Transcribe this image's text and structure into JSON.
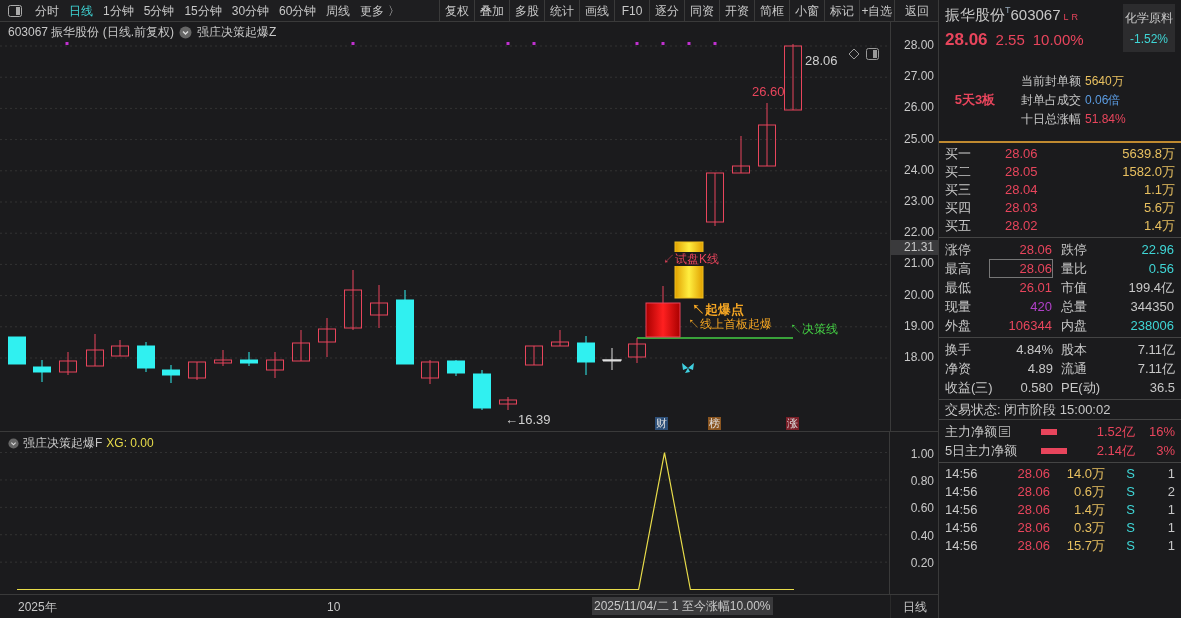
{
  "toolbar": {
    "periods": [
      {
        "label": "分时",
        "selected": false
      },
      {
        "label": "日线",
        "selected": true
      },
      {
        "label": "1分钟",
        "selected": false
      },
      {
        "label": "5分钟",
        "selected": false
      },
      {
        "label": "15分钟",
        "selected": false
      },
      {
        "label": "30分钟",
        "selected": false
      },
      {
        "label": "60分钟",
        "selected": false
      },
      {
        "label": "周线",
        "selected": false
      },
      {
        "label": "更多 〉",
        "selected": false
      }
    ],
    "buttons": [
      "复权",
      "叠加",
      "多股",
      "统计",
      "画线",
      "F10",
      "逐分",
      "同资",
      "开资",
      "简框",
      "小窗",
      "标记",
      "+自选",
      "返回"
    ]
  },
  "chart": {
    "title": "603067 振华股份 (日线.前复权)",
    "indicator": "强庄决策起爆Z",
    "price_ticks": [
      "28.00",
      "27.00",
      "26.00",
      "25.00",
      "24.00",
      "23.00",
      "22.00",
      "21.00",
      "20.00",
      "19.00",
      "18.00"
    ],
    "cursor_price": "21.31",
    "price_notes": [
      {
        "text": "28.06",
        "color": "#d0d0d0"
      },
      {
        "text": "26.60",
        "color": "#e8455c"
      },
      {
        "text": "←16.39",
        "color": "#d0d0d0"
      }
    ],
    "signals": [
      {
        "text": "↙试盘K线",
        "color": "#e8455c"
      },
      {
        "text": "↖起爆点",
        "color": "#f5a623"
      },
      {
        "text": "↖线上首板起爆",
        "color": "#f5a623"
      },
      {
        "text": "↖决策线",
        "color": "#44d044"
      }
    ],
    "events": [
      {
        "text": "财",
        "color": "#2d4f78"
      },
      {
        "text": "榜",
        "color": "#8a5520"
      },
      {
        "text": "涨",
        "color": "#7a1f28"
      }
    ]
  },
  "indicator_panel": {
    "name": "强庄决策起爆F",
    "reading": "XG: 0.00",
    "chart_data": {
      "type": "line",
      "series": [
        {
          "color": "#e8dc4a",
          "values": [
            0,
            0,
            0,
            0,
            0,
            0,
            0,
            0,
            0,
            0,
            0,
            0,
            0,
            0,
            0,
            0,
            0,
            0,
            0,
            0,
            0,
            0,
            0,
            0,
            0,
            1,
            0,
            0,
            0,
            0,
            0,
            null,
            null,
            null
          ]
        }
      ],
      "ylim": [
        -0.04,
        1.15
      ],
      "grid": true,
      "yticks": [
        {
          "value": 0.2,
          "label": "0.20"
        },
        {
          "value": 0.4,
          "label": "0.40"
        },
        {
          "value": 0.6,
          "label": "0.60"
        },
        {
          "value": 0.8,
          "label": "0.80"
        },
        {
          "value": 1,
          "label": "1.00"
        }
      ]
    }
  },
  "time_axis": {
    "labels": [
      "2025年",
      "10"
    ],
    "cursor": "2025/11/04/二 1 至今涨幅10.00%",
    "period": "日线"
  },
  "quote": {
    "name": "振华股份",
    "mark": "T",
    "code": "603067",
    "flags": [
      "L",
      "R"
    ],
    "price": "28.06",
    "change": "2.55",
    "change_pct": "10.00%",
    "sector": "化学原料",
    "sector_pct": "-1.52%",
    "streak": "5天3板",
    "limit_info": [
      {
        "label": "当前封单额",
        "value": "5640万",
        "color": "#e8c060"
      },
      {
        "label": "封单占成交",
        "value": "0.06倍",
        "color": "#5b9be0"
      },
      {
        "label": "十日总涨幅",
        "value": "51.84%",
        "color": "#e8455c"
      }
    ],
    "bids": [
      {
        "label": "买一",
        "price": "28.06",
        "volume": "5639.8万"
      },
      {
        "label": "买二",
        "price": "28.05",
        "volume": "1582.0万"
      },
      {
        "label": "买三",
        "price": "28.04",
        "volume": "1.1万"
      },
      {
        "label": "买四",
        "price": "28.03",
        "volume": "5.6万"
      },
      {
        "label": "买五",
        "price": "28.02",
        "volume": "1.4万"
      }
    ],
    "stats": [
      {
        "label": "涨停",
        "value": "28.06",
        "color": "#e8455c",
        "boxed": false
      },
      {
        "label": "跌停",
        "value": "22.96",
        "color": "#3fd6d6",
        "boxed": false
      },
      {
        "label": "最高",
        "value": "28.06",
        "color": "#e8455c",
        "boxed": true
      },
      {
        "label": "量比",
        "value": "0.56",
        "color": "#3fd6d6",
        "boxed": false
      },
      {
        "label": "最低",
        "value": "26.01",
        "color": "#e8455c",
        "boxed": false
      },
      {
        "label": "市值",
        "value": "199.4亿",
        "color": "#c8c8c8",
        "boxed": false
      },
      {
        "label": "现量",
        "value": "420",
        "color": "#b040c8",
        "boxed": false
      },
      {
        "label": "总量",
        "value": "344350",
        "color": "#c8c8c8",
        "boxed": false
      },
      {
        "label": "外盘",
        "value": "106344",
        "color": "#e8455c",
        "boxed": false
      },
      {
        "label": "内盘",
        "value": "238006",
        "color": "#3fd6d6",
        "boxed": false
      }
    ],
    "fundamentals": [
      {
        "label": "换手",
        "value": "4.84%"
      },
      {
        "label": "股本",
        "value": "7.11亿"
      },
      {
        "label": "净资",
        "value": "4.89"
      },
      {
        "label": "流通",
        "value": "7.11亿"
      },
      {
        "label": "收益(三)",
        "value": "0.580"
      },
      {
        "label": "PE(动)",
        "value": "36.5"
      }
    ],
    "status": "交易状态: 闭市阶段 15:00:02",
    "flows": [
      {
        "label": "主力净额",
        "detail_icon": true,
        "amount": "1.52亿",
        "pct": "16%"
      },
      {
        "label": "5日主力净额",
        "detail_icon": false,
        "amount": "2.14亿",
        "pct": "3%"
      }
    ],
    "trades": [
      {
        "time": "14:56",
        "price": "28.06",
        "volume": "14.0万",
        "side": "S",
        "count": "1"
      },
      {
        "time": "14:56",
        "price": "28.06",
        "volume": "0.6万",
        "side": "S",
        "count": "2"
      },
      {
        "time": "14:56",
        "price": "28.06",
        "volume": "1.4万",
        "side": "S",
        "count": "1"
      },
      {
        "time": "14:56",
        "price": "28.06",
        "volume": "0.3万",
        "side": "S",
        "count": "1"
      },
      {
        "time": "14:56",
        "price": "28.06",
        "volume": "15.7万",
        "side": "S",
        "count": "1"
      }
    ]
  }
}
